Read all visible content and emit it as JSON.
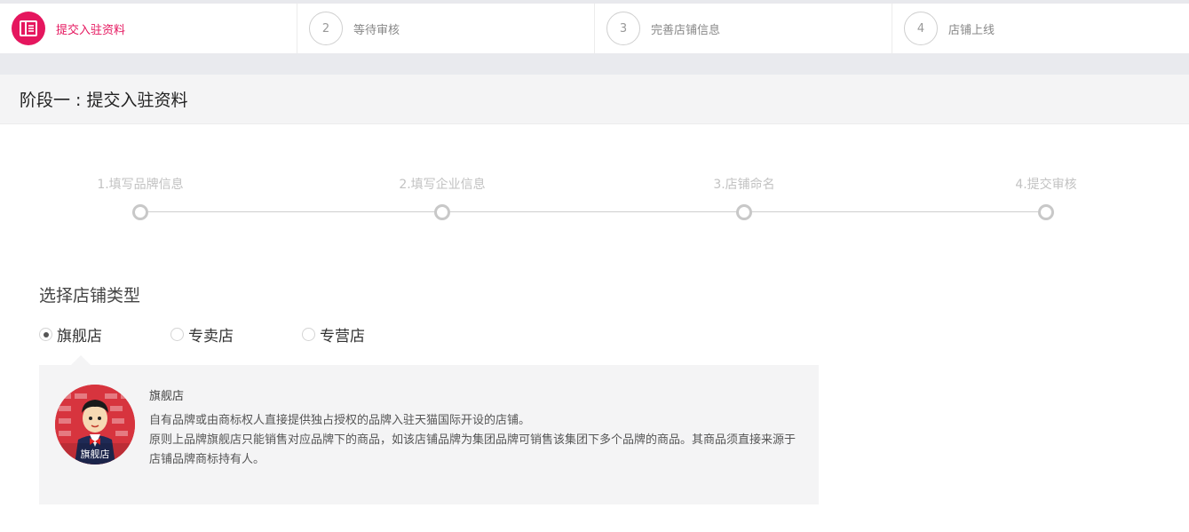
{
  "top_steps": [
    {
      "number": "",
      "label": "提交入驻资料",
      "active": true
    },
    {
      "number": "2",
      "label": "等待审核",
      "active": false
    },
    {
      "number": "3",
      "label": "完善店铺信息",
      "active": false
    },
    {
      "number": "4",
      "label": "店铺上线",
      "active": false
    }
  ],
  "stage_title": "阶段一 : 提交入驻资料",
  "progress_steps": [
    "1.填写品牌信息",
    "2.填写企业信息",
    "3.店铺命名",
    "4.提交审核"
  ],
  "store_type": {
    "title": "选择店铺类型",
    "options": [
      {
        "label": "旗舰店",
        "checked": true
      },
      {
        "label": "专卖店",
        "checked": false
      },
      {
        "label": "专营店",
        "checked": false
      }
    ]
  },
  "info": {
    "badge": "旗舰店",
    "title": "旗舰店",
    "line1": "自有品牌或由商标权人直接提供独占授权的品牌入驻天猫国际开设的店铺。",
    "line2": "原则上品牌旗舰店只能销售对应品牌下的商品，如该店铺品牌为集团品牌可销售该集团下多个品牌的商品。其商品须直接来源于店铺品牌商标持有人。"
  },
  "colors": {
    "accent": "#e5165e",
    "badge_bg": "#d7343e"
  },
  "icons": {
    "step1": "document-icon",
    "avatar": "mascot-avatar"
  }
}
